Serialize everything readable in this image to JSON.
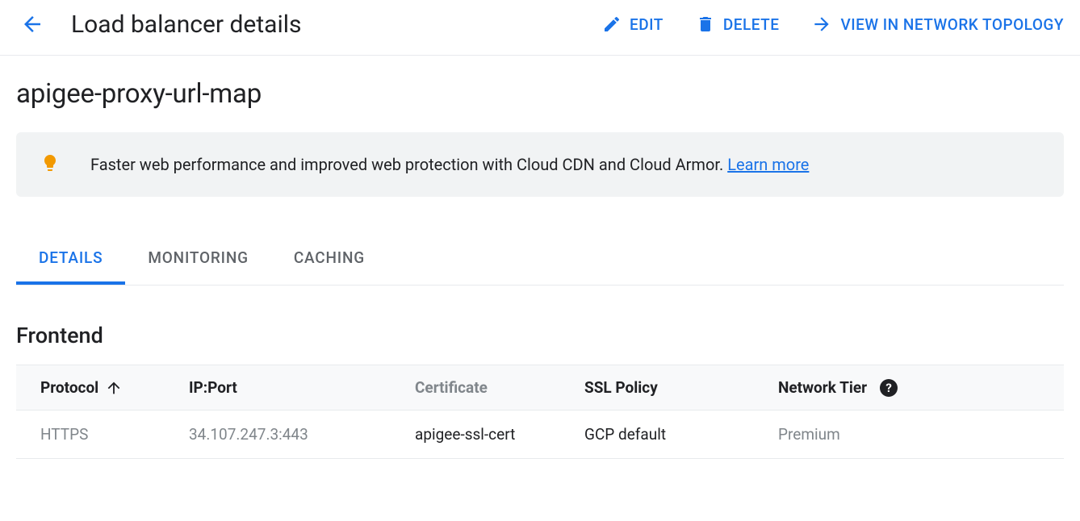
{
  "header": {
    "title": "Load balancer details",
    "actions": {
      "edit": "EDIT",
      "delete": "DELETE",
      "topology": "VIEW IN NETWORK TOPOLOGY"
    }
  },
  "resource": {
    "name": "apigee-proxy-url-map"
  },
  "banner": {
    "text": "Faster web performance and improved web protection with Cloud CDN and Cloud Armor. ",
    "link_label": "Learn more"
  },
  "tabs": {
    "details": "DETAILS",
    "monitoring": "MONITORING",
    "caching": "CACHING"
  },
  "frontend": {
    "heading": "Frontend",
    "columns": {
      "protocol": "Protocol",
      "ip_port": "IP:Port",
      "certificate": "Certificate",
      "ssl_policy": "SSL Policy",
      "network_tier": "Network Tier"
    },
    "rows": [
      {
        "protocol": "HTTPS",
        "ip_port": "34.107.247.3:443",
        "certificate": "apigee-ssl-cert",
        "ssl_policy": "GCP default",
        "network_tier": "Premium"
      }
    ]
  }
}
